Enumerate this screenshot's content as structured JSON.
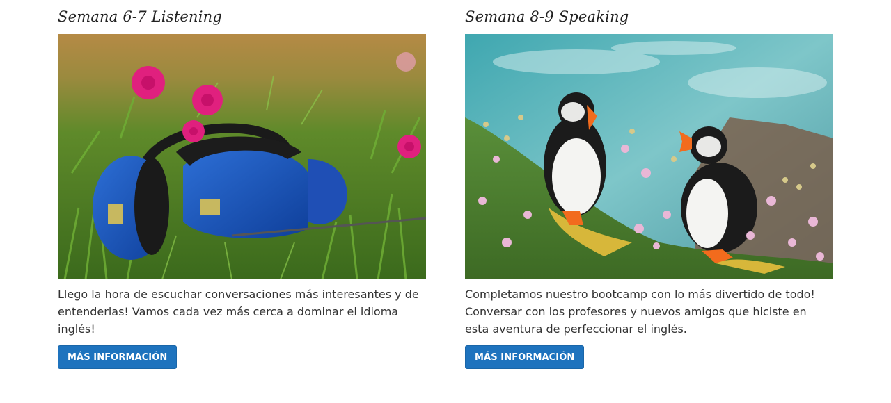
{
  "cards": [
    {
      "title": "Semana 6-7 Listening",
      "image": "headphones-on-grass-with-pink-flowers",
      "text": "Llego la hora de escuchar conversaciones más interesantes y de entenderlas! Vamos cada vez más cerca a dominar el idioma inglés!",
      "button_label": "MÁS INFORMACIÓN"
    },
    {
      "title": "Semana 8-9 Speaking",
      "image": "two-puffins-on-cliff-with-flowers",
      "text": "Completamos nuestro bootcamp con lo más divertido de todo! Conversar con los profesores y nuevos amigos que hiciste en esta aventura de perfeccionar el inglés.",
      "button_label": "MÁS INFORMACIÓN"
    }
  ],
  "colors": {
    "button_bg": "#1e73be",
    "button_text": "#ffffff",
    "body_text": "#333333"
  }
}
